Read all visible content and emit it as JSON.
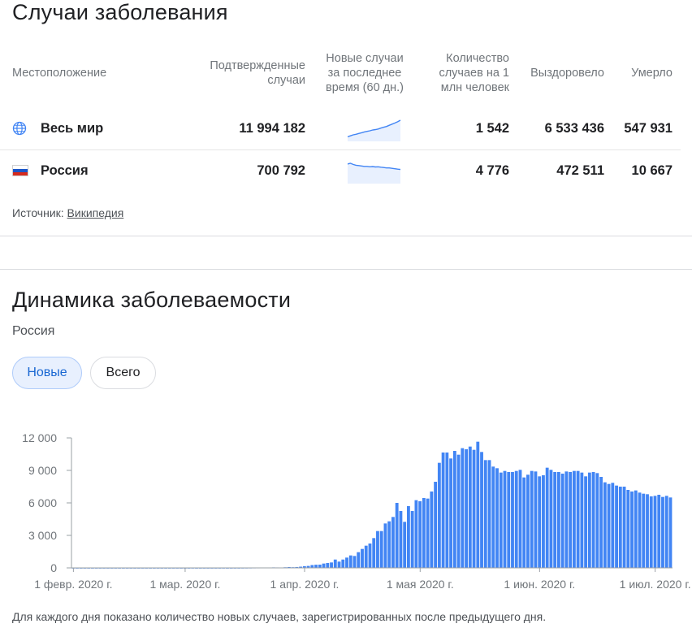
{
  "stats": {
    "title": "Случаи заболевания",
    "headers": {
      "location": "Местоположение",
      "confirmed": [
        "Подтвержденные",
        "случаи"
      ],
      "new60": [
        "Новые случаи",
        "за последнее",
        "время (60 дн.)"
      ],
      "per_million": [
        "Количество",
        "случаев на 1",
        "млн человек"
      ],
      "recovered": "Выздоровело",
      "deaths": "Умерло"
    },
    "rows": [
      {
        "location": "Весь мир",
        "icon": "globe-icon",
        "confirmed": "11 994 182",
        "trend": [
          0.15,
          0.2,
          0.25,
          0.28,
          0.32,
          0.36,
          0.4,
          0.43,
          0.46,
          0.5,
          0.52,
          0.55,
          0.6,
          0.64,
          0.68,
          0.74,
          0.8,
          0.86,
          0.92,
          1.0
        ],
        "per_million": "1 542",
        "recovered": "6 533 436",
        "deaths": "547 931"
      },
      {
        "location": "Россия",
        "icon": "russia-flag-icon",
        "confirmed": "700 792",
        "trend": [
          0.92,
          0.96,
          0.9,
          0.86,
          0.84,
          0.82,
          0.8,
          0.8,
          0.78,
          0.79,
          0.77,
          0.78,
          0.76,
          0.74,
          0.72,
          0.72,
          0.7,
          0.68,
          0.66,
          0.64
        ],
        "per_million": "4 776",
        "recovered": "472 511",
        "deaths": "10 667"
      }
    ],
    "source_label": "Источник:",
    "source_link": "Википедия"
  },
  "dynamics": {
    "title": "Динамика заболеваемости",
    "subtitle": "Россия",
    "chips": {
      "new": "Новые",
      "total": "Всего"
    },
    "footnote": "Для каждого дня показано количество новых случаев, зарегистрированных после предыдущего дня."
  },
  "colors": {
    "bar": "#4285f4",
    "spark": "#4285f4",
    "spark_fill": "#e8f0fe"
  },
  "chart_data": {
    "type": "bar",
    "title": "",
    "xlabel": "",
    "ylabel": "",
    "ylim": [
      0,
      12000
    ],
    "yticks": [
      0,
      3000,
      6000,
      9000,
      12000
    ],
    "ytick_labels": [
      "0",
      "3 000",
      "6 000",
      "9 000",
      "12 000"
    ],
    "xtick_labels": [
      "1 февр. 2020 г.",
      "1 мар. 2020 г.",
      "1 апр. 2020 г.",
      "1 мая 2020 г.",
      "1 июн. 2020 г.",
      "1 июл. 2020 г."
    ],
    "xtick_day_index": [
      0,
      29,
      60,
      90,
      121,
      151
    ],
    "start_label": "31 янв. 2020 г.",
    "series": [
      {
        "values": [
          2,
          0,
          0,
          0,
          0,
          0,
          0,
          0,
          0,
          0,
          0,
          0,
          0,
          0,
          0,
          0,
          0,
          0,
          0,
          0,
          0,
          0,
          0,
          0,
          0,
          0,
          0,
          0,
          0,
          0,
          0,
          3,
          0,
          0,
          0,
          0,
          0,
          0,
          0,
          2,
          0,
          1,
          2,
          2,
          6,
          8,
          12,
          18,
          20,
          27,
          30,
          25,
          45,
          40,
          35,
          55,
          75,
          60,
          80,
          110,
          160,
          180,
          260,
          290,
          300,
          400,
          450,
          500,
          770,
          580,
          770,
          950,
          1150,
          1100,
          1450,
          1750,
          2050,
          2250,
          2750,
          3400,
          3400,
          4100,
          4300,
          4700,
          6000,
          5250,
          4250,
          5700,
          5250,
          6250,
          6150,
          6450,
          6400,
          7050,
          7950,
          9700,
          10650,
          10650,
          10100,
          10800,
          10450,
          11050,
          10950,
          11200,
          10900,
          11650,
          10700,
          9950,
          9950,
          9350,
          9200,
          8800,
          8950,
          8850,
          8850,
          8950,
          9050,
          8350,
          8600,
          8950,
          8900,
          8450,
          8550,
          9250,
          9050,
          8850,
          8850,
          8700,
          8900,
          8850,
          8950,
          8950,
          8800,
          8450,
          8800,
          8850,
          8750,
          8400,
          7900,
          7750,
          7850,
          7600,
          7500,
          7500,
          7200,
          7050,
          7150,
          6950,
          6850,
          6800,
          6600,
          6650,
          6750,
          6550,
          6650,
          6500
        ]
      }
    ]
  }
}
